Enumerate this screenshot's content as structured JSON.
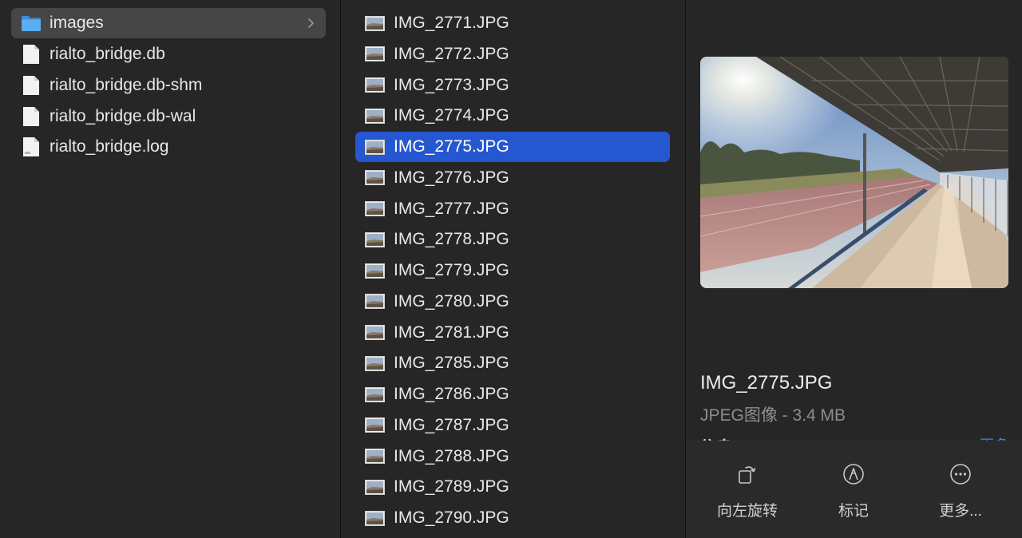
{
  "folder_column": {
    "items": [
      {
        "label": "images",
        "type": "folder",
        "selected": true
      },
      {
        "label": "rialto_bridge.db",
        "type": "file"
      },
      {
        "label": "rialto_bridge.db-shm",
        "type": "file"
      },
      {
        "label": "rialto_bridge.db-wal",
        "type": "file"
      },
      {
        "label": "rialto_bridge.log",
        "type": "file"
      }
    ]
  },
  "files_column": {
    "items": [
      {
        "label": "IMG_2771.JPG"
      },
      {
        "label": "IMG_2772.JPG"
      },
      {
        "label": "IMG_2773.JPG"
      },
      {
        "label": "IMG_2774.JPG"
      },
      {
        "label": "IMG_2775.JPG",
        "selected": true
      },
      {
        "label": "IMG_2776.JPG"
      },
      {
        "label": "IMG_2777.JPG"
      },
      {
        "label": "IMG_2778.JPG"
      },
      {
        "label": "IMG_2779.JPG"
      },
      {
        "label": "IMG_2780.JPG"
      },
      {
        "label": "IMG_2781.JPG"
      },
      {
        "label": "IMG_2785.JPG"
      },
      {
        "label": "IMG_2786.JPG"
      },
      {
        "label": "IMG_2787.JPG"
      },
      {
        "label": "IMG_2788.JPG"
      },
      {
        "label": "IMG_2789.JPG"
      },
      {
        "label": "IMG_2790.JPG"
      }
    ]
  },
  "preview": {
    "file_name": "IMG_2775.JPG",
    "file_kind": "JPEG图像 - 3.4 MB",
    "info_label": "信息",
    "info_more": "更多",
    "actions": [
      {
        "label": "向左旋转",
        "icon": "rotate-left-icon"
      },
      {
        "label": "标记",
        "icon": "markup-icon"
      },
      {
        "label": "更多...",
        "icon": "more-icon"
      }
    ]
  },
  "colors": {
    "background": "#262626",
    "selection_blue": "#2558d0",
    "selection_gray": "#464646",
    "folder_blue": "#5aaef0"
  }
}
